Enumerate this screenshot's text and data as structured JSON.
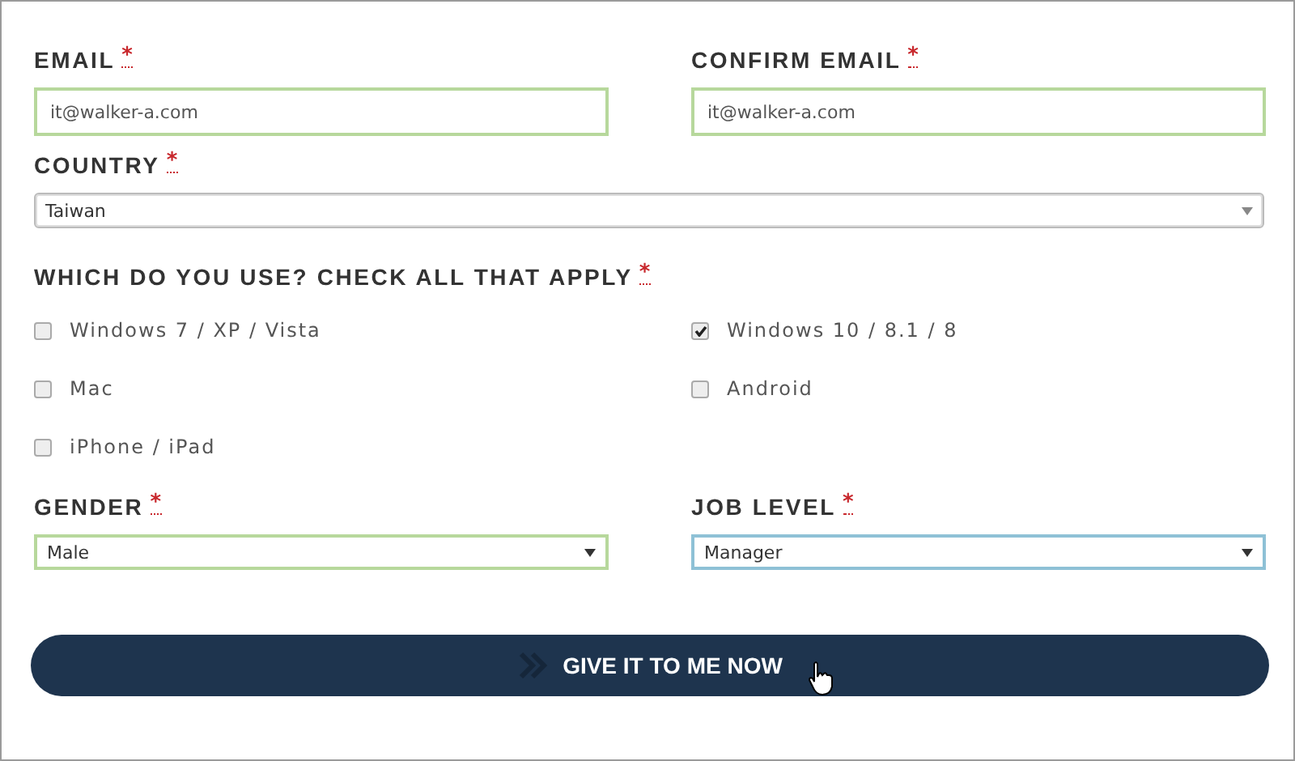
{
  "email": {
    "label": "EMAIL",
    "required_mark": "*",
    "value": "it@walker-a.com",
    "valid": true,
    "focused": false
  },
  "confirm_email": {
    "label": "CONFIRM EMAIL",
    "required_mark": "*",
    "value": "it@walker-a.com",
    "valid": true,
    "focused": false
  },
  "country": {
    "label": "COUNTRY",
    "required_mark": "*",
    "value": "Taiwan",
    "valid": false,
    "focused": false
  },
  "platforms": {
    "label": "WHICH DO YOU USE? CHECK ALL THAT APPLY",
    "required_mark": "*",
    "options": [
      {
        "label": "Windows 7 / XP / Vista",
        "checked": false
      },
      {
        "label": "Windows 10 / 8.1 / 8",
        "checked": true
      },
      {
        "label": "Mac",
        "checked": false
      },
      {
        "label": "Android",
        "checked": false
      },
      {
        "label": "iPhone / iPad",
        "checked": false
      }
    ]
  },
  "gender": {
    "label": "GENDER",
    "required_mark": "*",
    "value": "Male",
    "valid": true,
    "focused": false
  },
  "job_level": {
    "label": "JOB LEVEL",
    "required_mark": "*",
    "value": "Manager",
    "valid": false,
    "focused": true
  },
  "submit": {
    "label": "GIVE IT TO ME NOW"
  }
}
